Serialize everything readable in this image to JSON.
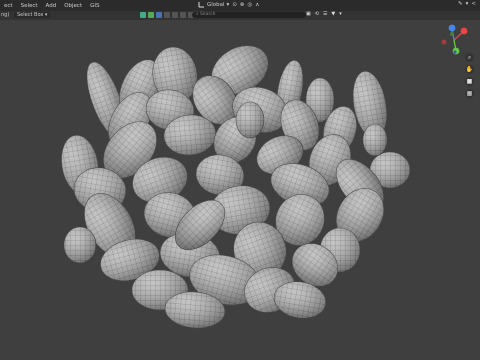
{
  "header": {
    "menu": [
      "ect",
      "Select",
      "Add",
      "Object",
      "GIS"
    ],
    "transform_orientation": "Global",
    "colors": {
      "bg": "#2b2b2b",
      "text": "#cfcfcf"
    }
  },
  "toolbar2": {
    "mode_left": "ng)",
    "select_box": "Select Box",
    "search_placeholder": "Search"
  },
  "gizmo": {
    "x": "X",
    "y": "Y",
    "z": "Z"
  },
  "viewport": {
    "bg": "#3f3f3f",
    "mesh": "#b8b8b8",
    "wire": "#5a5a5a"
  }
}
